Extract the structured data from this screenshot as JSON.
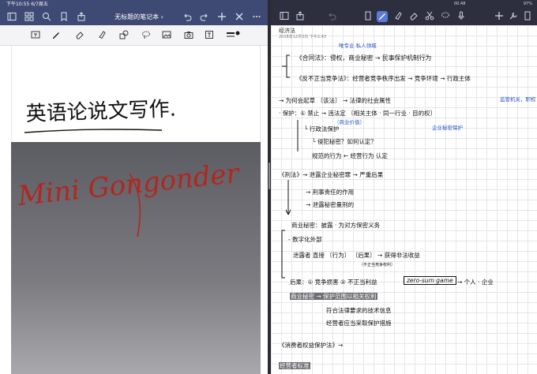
{
  "left_pane": {
    "status": {
      "time": "下午10:55  6/7周五"
    },
    "navbar": {
      "title": "无标题的笔记本",
      "icons": [
        "sidebar-icon",
        "grid-icon",
        "search-icon",
        "bookmark-icon",
        "share-icon"
      ],
      "right_icons": [
        "undo-icon",
        "redo-icon",
        "add-icon",
        "close-icon",
        "more-icon"
      ]
    },
    "tools": [
      "text-box-icon",
      "pen-icon",
      "eraser-icon",
      "highlighter-icon",
      "shape-icon",
      "lasso-icon",
      "image-icon",
      "camera-icon",
      "textbox-icon",
      "pen-size-icon"
    ],
    "handwriting": [
      "英语论说文写作.",
      "Mini Gongonder"
    ]
  },
  "right_pane": {
    "status": {
      "time": "00:48",
      "battery": "97%"
    },
    "toolbar_left": [
      "notebooks-icon",
      "share-icon",
      "undo-icon"
    ],
    "toolbar_tools": [
      "pen-icon",
      "highlighter-icon",
      "eraser-icon",
      "scissors-icon",
      "lasso-icon",
      "mic-icon"
    ],
    "toolbar_right": [
      "add-icon",
      "settings-icon",
      "page-icon"
    ],
    "note_title": "经济法",
    "note_date": "2018年12月3日  下午2:43",
    "notes": [
      "《合同法》：侵权，商业秘密 → 民事保护机制行为",
      "唯专业 私人领域",
      "《反不正当竞争法》：经营者竞争秩序出发 → 竞争环境 → 行政主体",
      "监管机关，职权",
      "→ 为何会起草 〔该法〕 → 法律的社会属性",
      "· 保护：① 禁止 → 违法定 〔相关主体 · 同一行业 · 目的权〕",
      "（商业价值）",
      "企业秘密保护",
      "└ 行政法保护",
      "└ 侵犯秘密？如何认定？",
      "规范的行为 ← 经营行为 认定",
      "《刑法》→ 泄露企业秘密罪 → 严重后果",
      "→ 刑事责任的作用",
      "→ 泄露秘密量刑的",
      "商业秘密：披露 · 为对方保密义务",
      "- 数字化外部",
      "泄露者 直接 〔行为〕 〔后果〕 → 获得非法收益",
      "（不正当竞争权利）",
      "后果：① 竞争损害 ② 不正当利益",
      "zero-sum game",
      "→ 个人 · 企业",
      "商业秘密 → 保护范围以相关权利",
      "符合法律要求的技术信息",
      "经营者应当采取保护措施",
      "《消费者权益保护法》→",
      "经营者标准"
    ]
  }
}
